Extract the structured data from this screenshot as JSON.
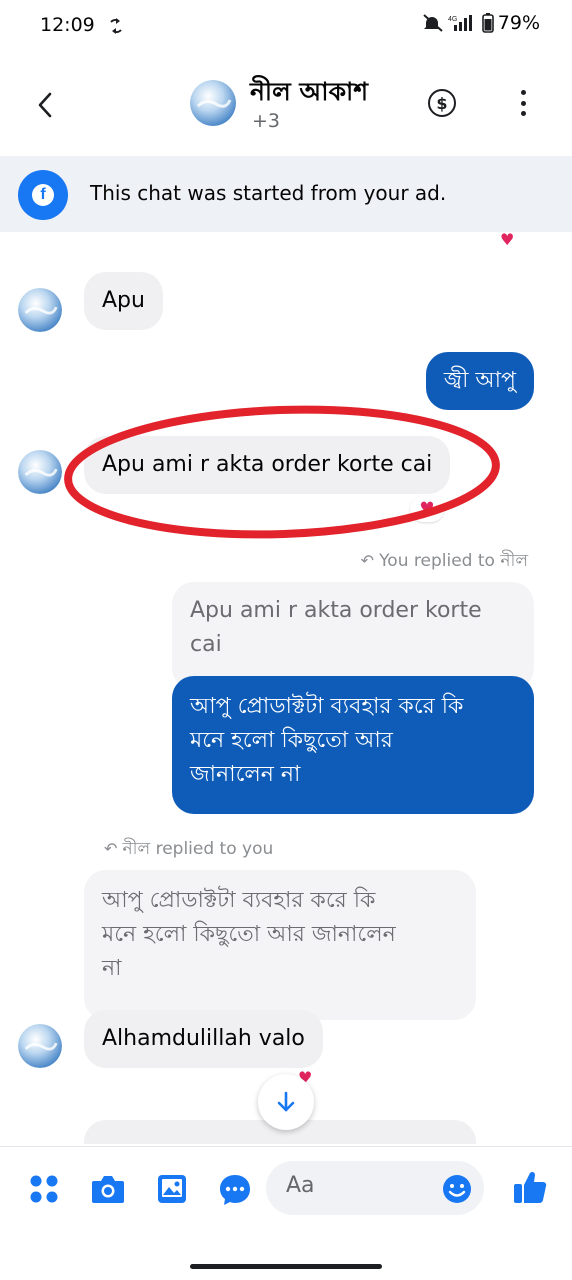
{
  "status_bar": {
    "time": "12:09",
    "battery": "79%"
  },
  "header": {
    "back_icon": "chevron-left-icon",
    "name": "নীল আকাশ",
    "subtitle": "+3",
    "dollar_icon": "dollar-icon",
    "more_icon": "more-vertical-icon"
  },
  "ad_banner": {
    "icon": "facebook-icon",
    "text": "This chat was started from your ad."
  },
  "messages": {
    "m1": "Apu",
    "m2": "জ্বী আপু",
    "m3": "Apu ami r akta order korte cai",
    "reply1_label": "You replied to নীল",
    "reply1_quote_line1": "Apu ami r akta order korte",
    "reply1_quote_line2": "cai",
    "m4_line1": "আপু প্রোডাক্টটা ব্যবহার করে কি",
    "m4_line2": "মনে হলো কিছুতো আর",
    "m4_line3": "জানালেন না",
    "reply2_label": "নীল replied to you",
    "reply2_quote_line1": "আপু প্রোডাক্টটা ব্যবহার করে কি",
    "reply2_quote_line2": "মনে হলো কিছুতো আর জানালেন",
    "reply2_quote_line3": "না",
    "m5": "Alhamdulillah valo",
    "heart_reaction": "❤️"
  },
  "composer": {
    "placeholder": "Aa",
    "icons": [
      "apps-icon",
      "camera-icon",
      "gallery-icon",
      "chat-bubble-icon",
      "emoji-icon",
      "like-icon"
    ]
  },
  "colors": {
    "brand_blue": "#1877f2",
    "outgoing_bubble": "#0f5cb8",
    "incoming_bubble": "#f0f0f2",
    "annotation_red": "#e2232c"
  }
}
